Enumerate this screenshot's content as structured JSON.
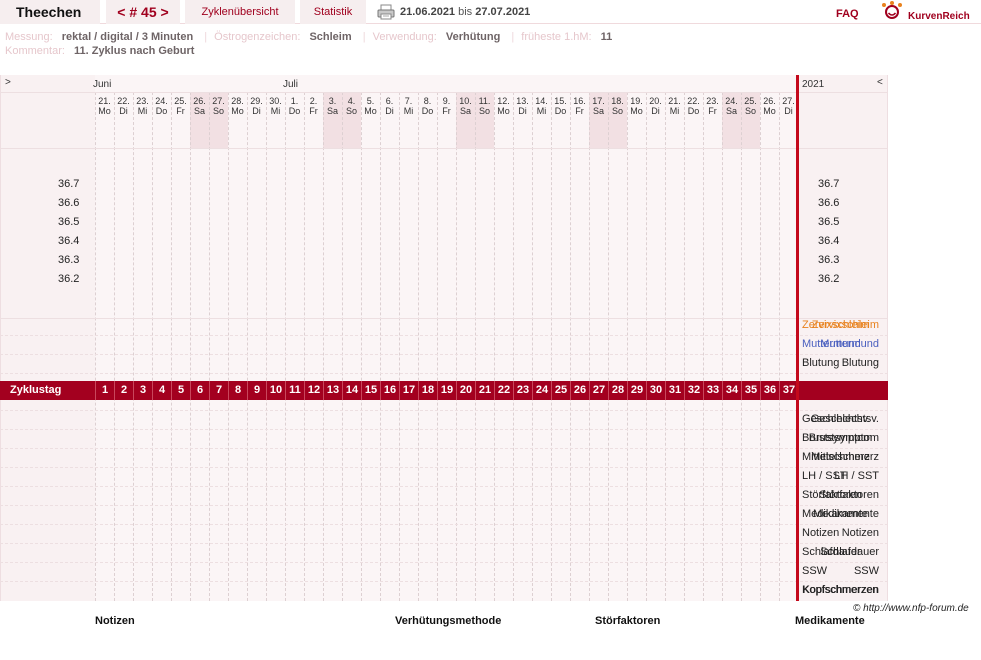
{
  "header": {
    "user_name": "Theechen",
    "cycle_nav_prev": "<",
    "cycle_nav_label": "# 45",
    "cycle_nav_next": ">",
    "tabs": [
      "Zyklenübersicht",
      "Statistik"
    ],
    "date_from": "21.06.2021",
    "date_bis": "bis",
    "date_to": "27.07.2021",
    "faq": "FAQ",
    "logo_text": "KurvenReich",
    "logo_icon": "smiley-crown-icon",
    "print_icon": "printer-icon"
  },
  "info": {
    "messung_key": "Messung:",
    "messung_val": "rektal / digital / 3 Minuten",
    "oestrogen_key": "Östrogenzeichen:",
    "oestrogen_val": "Schleim",
    "verwendung_key": "Verwendung:",
    "verwendung_val": "Verhütung",
    "hm_key": "früheste 1.hM:",
    "hm_val": "11",
    "kommentar_key": "Kommentar:",
    "kommentar_val": "11. Zyklus nach Geburt"
  },
  "chart": {
    "nav_left": ">",
    "nav_right": "<",
    "year": "2021",
    "months": [
      {
        "label": "Juni",
        "day_index": 0
      },
      {
        "label": "Juli",
        "day_index": 10
      }
    ],
    "days": [
      {
        "d": "21.",
        "w": "Mo"
      },
      {
        "d": "22.",
        "w": "Di"
      },
      {
        "d": "23.",
        "w": "Mi"
      },
      {
        "d": "24.",
        "w": "Do"
      },
      {
        "d": "25.",
        "w": "Fr"
      },
      {
        "d": "26.",
        "w": "Sa"
      },
      {
        "d": "27.",
        "w": "So"
      },
      {
        "d": "28.",
        "w": "Mo"
      },
      {
        "d": "29.",
        "w": "Di"
      },
      {
        "d": "30.",
        "w": "Mi"
      },
      {
        "d": "1.",
        "w": "Do"
      },
      {
        "d": "2.",
        "w": "Fr"
      },
      {
        "d": "3.",
        "w": "Sa"
      },
      {
        "d": "4.",
        "w": "So"
      },
      {
        "d": "5.",
        "w": "Mo"
      },
      {
        "d": "6.",
        "w": "Di"
      },
      {
        "d": "7.",
        "w": "Mi"
      },
      {
        "d": "8.",
        "w": "Do"
      },
      {
        "d": "9.",
        "w": "Fr"
      },
      {
        "d": "10.",
        "w": "Sa"
      },
      {
        "d": "11.",
        "w": "So"
      },
      {
        "d": "12.",
        "w": "Mo"
      },
      {
        "d": "13.",
        "w": "Di"
      },
      {
        "d": "14.",
        "w": "Mi"
      },
      {
        "d": "15.",
        "w": "Do"
      },
      {
        "d": "16.",
        "w": "Fr"
      },
      {
        "d": "17.",
        "w": "Sa"
      },
      {
        "d": "18.",
        "w": "So"
      },
      {
        "d": "19.",
        "w": "Mo"
      },
      {
        "d": "20.",
        "w": "Di"
      },
      {
        "d": "21.",
        "w": "Mi"
      },
      {
        "d": "22.",
        "w": "Do"
      },
      {
        "d": "23.",
        "w": "Fr"
      },
      {
        "d": "24.",
        "w": "Sa"
      },
      {
        "d": "25.",
        "w": "So"
      },
      {
        "d": "26.",
        "w": "Mo"
      },
      {
        "d": "27.",
        "w": "Di"
      }
    ],
    "temperatures": [
      "36.7",
      "36.6",
      "36.5",
      "36.4",
      "36.3",
      "36.2"
    ],
    "obs_rows": [
      {
        "label": "Zervixschleim",
        "color": "#e8821e"
      },
      {
        "label": "Muttermund",
        "color": "#4a5fbf"
      },
      {
        "label": "Blutung",
        "color": "#222222"
      }
    ],
    "cycle_day_label": "Zyklustag",
    "cycle_days": [
      "1",
      "2",
      "3",
      "4",
      "5",
      "6",
      "7",
      "8",
      "9",
      "10",
      "11",
      "12",
      "13",
      "14",
      "15",
      "16",
      "17",
      "18",
      "19",
      "20",
      "21",
      "22",
      "23",
      "24",
      "25",
      "26",
      "27",
      "28",
      "29",
      "30",
      "31",
      "32",
      "33",
      "34",
      "35",
      "36",
      "37"
    ],
    "symptom_rows": [
      "Geschlechtsv.",
      "Brustsymptom",
      "Mittelschmerz",
      "LH / SST",
      "Störfaktoren",
      "Medikamente",
      "Notizen",
      "Schlafdauer",
      "SSW",
      "Kopfschmerzen"
    ]
  },
  "footer": {
    "copyright": "© http://www.nfp-forum.de",
    "headings": [
      "Notizen",
      "Verhütungsmethode",
      "Störfaktoren",
      "Medikamente"
    ]
  },
  "colors": {
    "accent": "#a3001f",
    "divider": "#c4091c",
    "weekend": "#f2e0e3"
  }
}
